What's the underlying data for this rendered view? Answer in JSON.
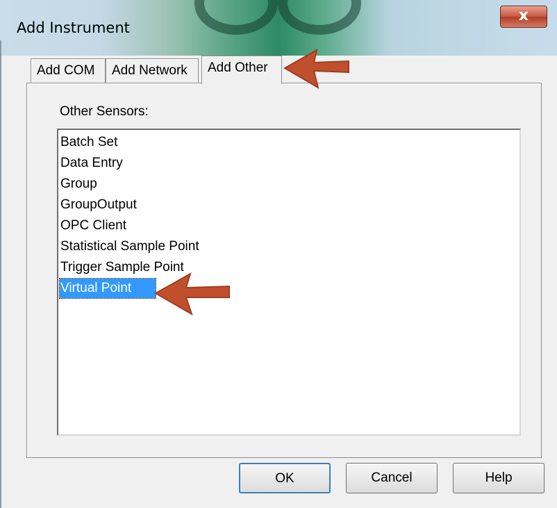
{
  "window": {
    "title": "Add Instrument",
    "close_label": "x"
  },
  "tabs": [
    {
      "label": "Add COM",
      "active": false
    },
    {
      "label": "Add Network",
      "active": false
    },
    {
      "label": "Add Other",
      "active": true
    }
  ],
  "panel": {
    "group_label": "Other Sensors:",
    "items": [
      {
        "label": "Batch Set",
        "selected": false
      },
      {
        "label": "Data Entry",
        "selected": false
      },
      {
        "label": "Group",
        "selected": false
      },
      {
        "label": "GroupOutput",
        "selected": false
      },
      {
        "label": "OPC Client",
        "selected": false
      },
      {
        "label": "Statistical Sample Point",
        "selected": false
      },
      {
        "label": "Trigger Sample Point",
        "selected": false
      },
      {
        "label": "Virtual Point",
        "selected": true
      }
    ]
  },
  "buttons": {
    "ok": "OK",
    "cancel": "Cancel",
    "help": "Help"
  },
  "colors": {
    "selection": "#3399ff",
    "annotation_arrow": "#c0502d"
  },
  "annotations": [
    {
      "icon": "arrow-left-icon",
      "points_to": "Add Other"
    },
    {
      "icon": "arrow-left-icon",
      "points_to": "Virtual Point"
    }
  ]
}
